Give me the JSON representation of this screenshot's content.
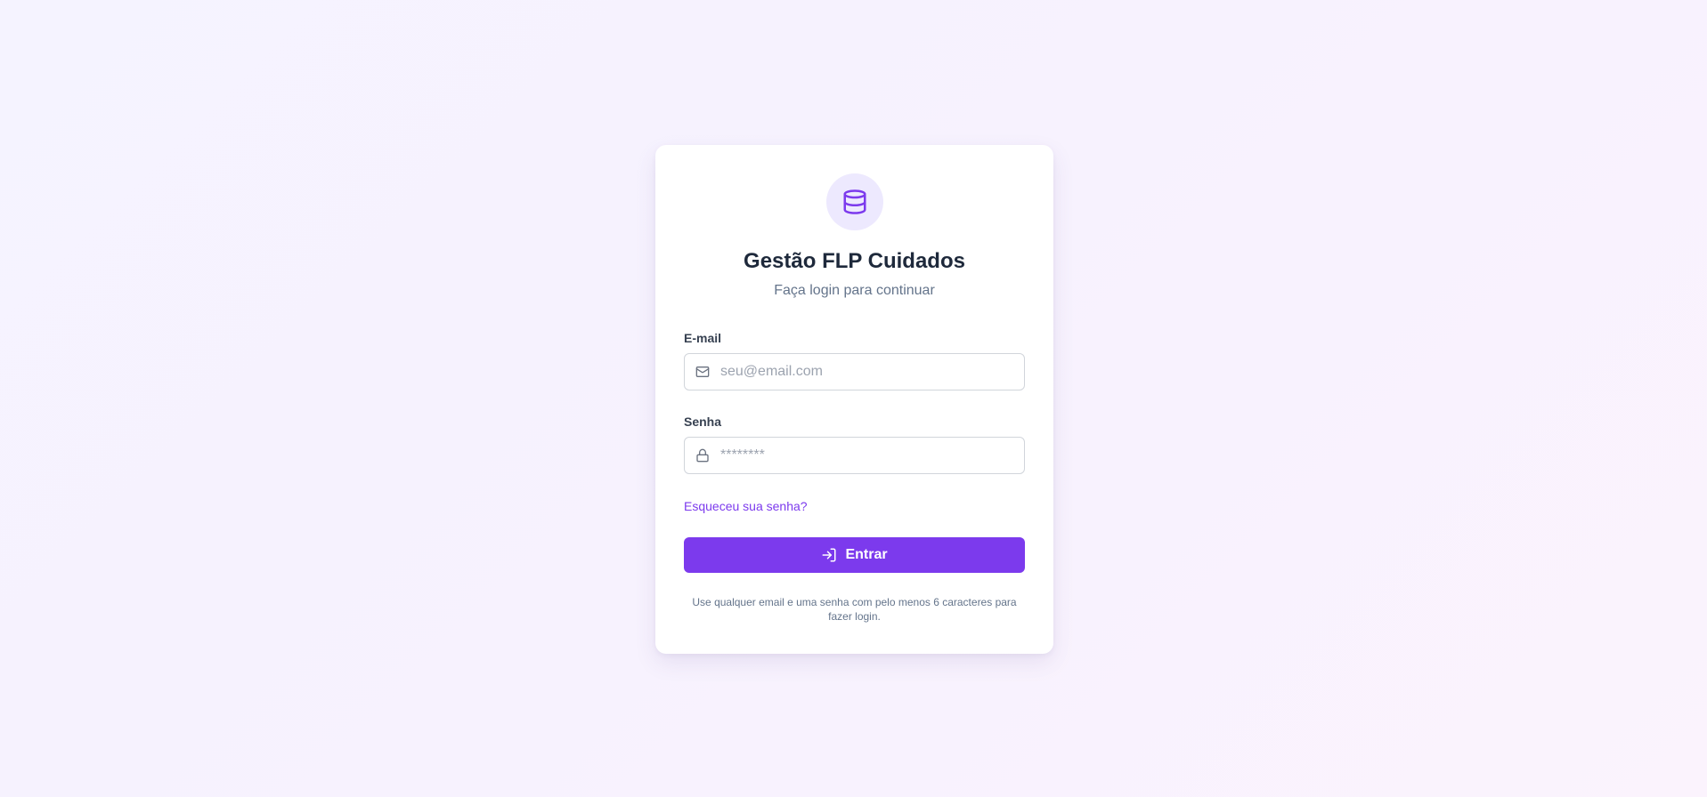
{
  "app": {
    "title": "Gestão FLP Cuidados",
    "subtitle": "Faça login para continuar",
    "logo_icon": "database-icon"
  },
  "form": {
    "email": {
      "label": "E-mail",
      "placeholder": "seu@email.com",
      "value": "",
      "icon": "mail-icon"
    },
    "password": {
      "label": "Senha",
      "placeholder": "********",
      "value": "",
      "icon": "lock-icon"
    },
    "forgot_link": "Esqueceu sua senha?",
    "submit_label": "Entrar",
    "submit_icon": "log-in-icon",
    "hint": "Use qualquer email e uma senha com pelo menos 6 caracteres para fazer login."
  },
  "colors": {
    "accent": "#7c3aed",
    "accent_soft": "#ede9fe",
    "title": "#1e293b",
    "muted": "#64748b",
    "border": "#d1d5db"
  }
}
